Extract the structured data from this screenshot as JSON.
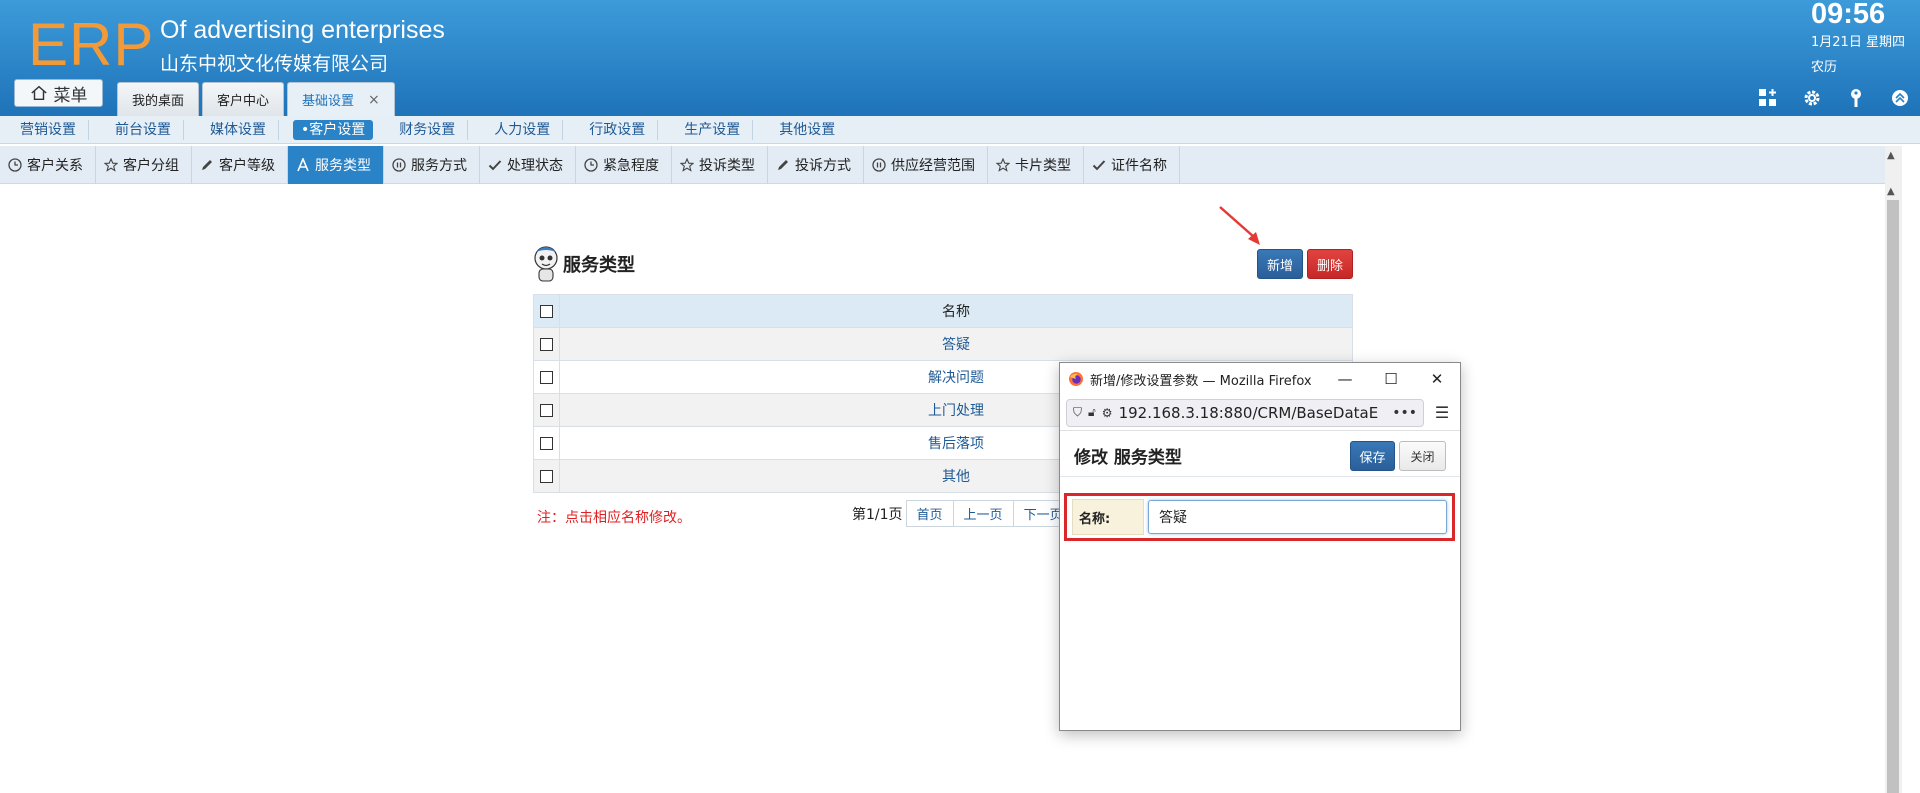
{
  "header": {
    "logo": "ERP",
    "company_en": "Of advertising enterprises",
    "company_cn": "山东中视文化传媒有限公司",
    "time": "09:56",
    "date": "1月21日 星期四",
    "lunar": "农历",
    "menu_label": "菜单",
    "tabs": [
      {
        "label": "我的桌面"
      },
      {
        "label": "客户中心"
      },
      {
        "label": "基础设置",
        "close": "×"
      }
    ],
    "icons": [
      "grid-icon",
      "gear-icon",
      "key-icon",
      "collapse-icon"
    ],
    "background_color": "#2a83c6",
    "logo_color": "#f29a38"
  },
  "nav2": [
    "营销设置",
    "前台设置",
    "媒体设置",
    "•客户设置",
    "财务设置",
    "人力设置",
    "行政设置",
    "生产设置",
    "其他设置"
  ],
  "nav3": [
    {
      "label": "客户关系",
      "icon": "clock-icon"
    },
    {
      "label": "客户分组",
      "icon": "star-icon"
    },
    {
      "label": "客户等级",
      "icon": "pencil-icon"
    },
    {
      "label": "服务类型",
      "icon": "font-icon"
    },
    {
      "label": "服务方式",
      "icon": "pause-icon"
    },
    {
      "label": "处理状态",
      "icon": "check-icon"
    },
    {
      "label": "紧急程度",
      "icon": "clock-icon"
    },
    {
      "label": "投诉类型",
      "icon": "star-icon"
    },
    {
      "label": "投诉方式",
      "icon": "pencil-icon"
    },
    {
      "label": "供应经营范围",
      "icon": "pause-icon"
    },
    {
      "label": "卡片类型",
      "icon": "star-icon"
    },
    {
      "label": "证件名称",
      "icon": "check-icon"
    }
  ],
  "main": {
    "title": "服务类型",
    "add_button": "新增",
    "delete_button": "删除",
    "table_header": "名称",
    "rows": [
      "答疑",
      "解决问题",
      "上门处理",
      "售后落项",
      "其他"
    ],
    "note": "注：点击相应名称修改。",
    "pager": {
      "info": "第1/1页",
      "first": "首页",
      "prev": "上一页",
      "next": "下一页"
    }
  },
  "popup": {
    "window_title": "新增/修改设置参数 — Mozilla Firefox",
    "url": "192.168.3.18:880/CRM/BaseDataE",
    "heading": "修改 服务类型",
    "save_button": "保存",
    "close_button": "关闭",
    "field_label": "名称:",
    "field_value": "答疑"
  }
}
